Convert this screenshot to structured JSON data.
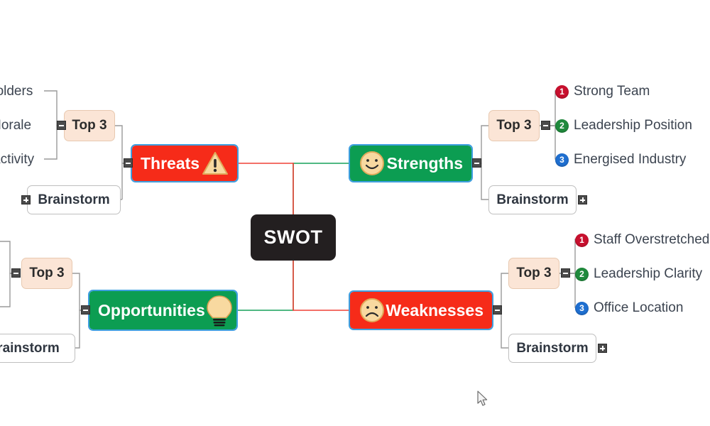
{
  "diagram": {
    "title": "SWOT",
    "root": {
      "label": "SWOT"
    },
    "colors": {
      "root_bg": "#231f20",
      "strength_green": "#0c9d52",
      "weakness_red": "#f62b19",
      "top3_bg": "#fbe5d6",
      "brainstorm_bg": "#ffffff",
      "selection_blue": "#3e9fe0",
      "badge_1_red": "#c8102e",
      "badge_2_green": "#1f8a3c",
      "badge_3_blue": "#1f6fd0",
      "connector_green": "#16a05a",
      "connector_red": "#ef4136",
      "connector_gray": "#9a9a9a"
    },
    "branches": [
      {
        "id": "strengths",
        "label": "Strengths",
        "icon": "smiley-face-icon",
        "color": "green",
        "side": "right",
        "top3": {
          "label": "Top 3"
        },
        "brainstorm": {
          "label": "Brainstorm"
        },
        "items": [
          {
            "number": "1",
            "label": "Strong Team"
          },
          {
            "number": "2",
            "label": "Leadership Position"
          },
          {
            "number": "3",
            "label": "Energised Industry"
          }
        ]
      },
      {
        "id": "weaknesses",
        "label": "Weaknesses",
        "icon": "sad-face-icon",
        "color": "red",
        "side": "right",
        "top3": {
          "label": "Top 3"
        },
        "brainstorm": {
          "label": "Brainstorm"
        },
        "items": [
          {
            "number": "1",
            "label": "Staff Overstretched"
          },
          {
            "number": "2",
            "label": "Leadership Clarity"
          },
          {
            "number": "3",
            "label": "Office Location"
          }
        ]
      },
      {
        "id": "threats",
        "label": "Threats",
        "icon": "warning-triangle-icon",
        "color": "red",
        "side": "left",
        "top3": {
          "label": "Top 3"
        },
        "brainstorm": {
          "label": "Brainstorm"
        },
        "items": [
          {
            "number": "",
            "label": "holders"
          },
          {
            "number": "",
            "label": "Morale"
          },
          {
            "number": "",
            "label": "Activity"
          }
        ]
      },
      {
        "id": "opportunities",
        "label": "Opportunities",
        "icon": "lightbulb-icon",
        "color": "green",
        "side": "left",
        "top3": {
          "label": "Top 3"
        },
        "brainstorm": {
          "label": "rainstorm"
        },
        "items": []
      }
    ]
  }
}
